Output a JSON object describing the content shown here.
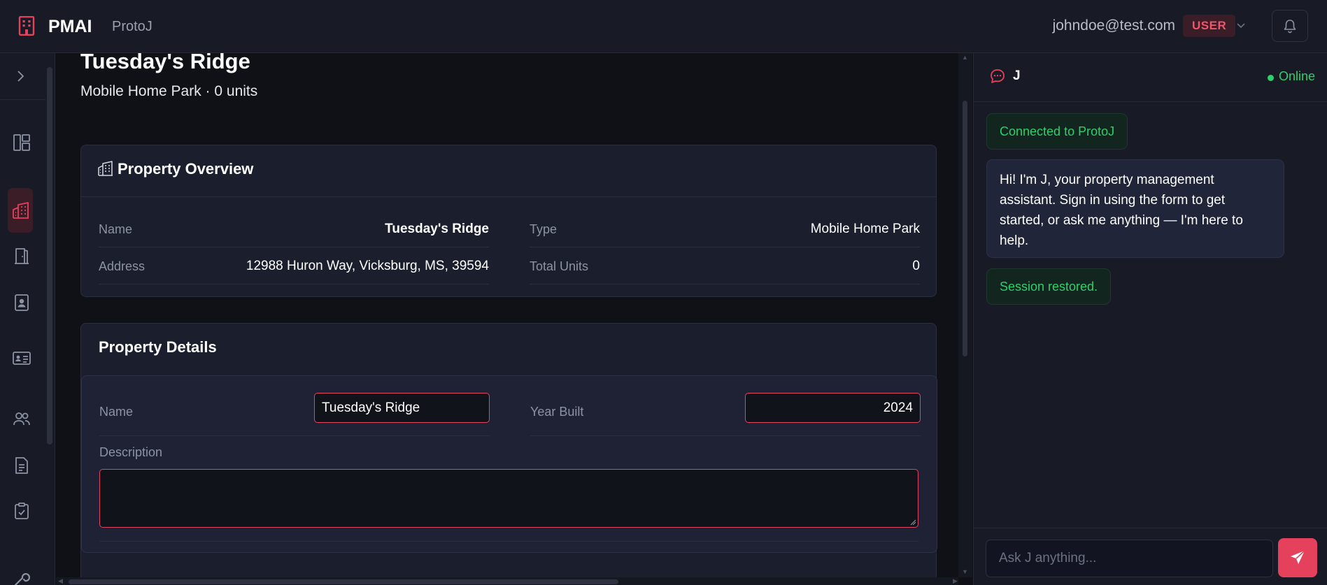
{
  "app": {
    "brand_name": "PMAI",
    "brand_sub": "ProtoJ"
  },
  "user": {
    "email": "johndoe@test.com",
    "role": "USER"
  },
  "page": {
    "title": "Tuesday's Ridge",
    "subtitle": "Mobile Home Park · 0 units"
  },
  "overview": {
    "title": "Property Overview",
    "rows": [
      {
        "label": "Name",
        "value": "Tuesday's Ridge"
      },
      {
        "label": "Type",
        "value": "Mobile Home Park"
      },
      {
        "label": "Address",
        "value": "12988 Huron Way, Vicksburg, MS, 39594"
      },
      {
        "label": "Total Units",
        "value": "0"
      }
    ]
  },
  "details": {
    "title": "Property Details",
    "name_label": "Name",
    "name_value": "Tuesday's Ridge",
    "year_label": "Year Built",
    "year_value": "2024",
    "description_label": "Description",
    "description_value": ""
  },
  "chat": {
    "assistant_name": "J",
    "status": "Online",
    "messages": [
      {
        "role": "system",
        "text": "Connected to ProtoJ"
      },
      {
        "role": "assistant",
        "text": "Hi! I'm J, your property management assistant. Sign in using the form to get started, or ask me anything — I'm here to help."
      },
      {
        "role": "system",
        "text": "Session restored."
      }
    ],
    "input_placeholder": "Ask J anything..."
  },
  "colors": {
    "accent": "#e6415c",
    "online": "#2fcf6b",
    "background": "#0f1117",
    "panel": "#181b26",
    "card": "#1b1f2d"
  },
  "icons": {
    "brand": "building-icon",
    "sidebar": [
      "chevron-right-icon",
      "dashboard-icon",
      "buildings-icon",
      "door-icon",
      "contact-badge-icon",
      "id-card-icon",
      "users-icon",
      "document-icon",
      "clipboard-check-icon",
      "wrench-icon"
    ],
    "notifications": "bell-icon",
    "chat": "chat-bubble-icon",
    "send": "send-icon"
  }
}
